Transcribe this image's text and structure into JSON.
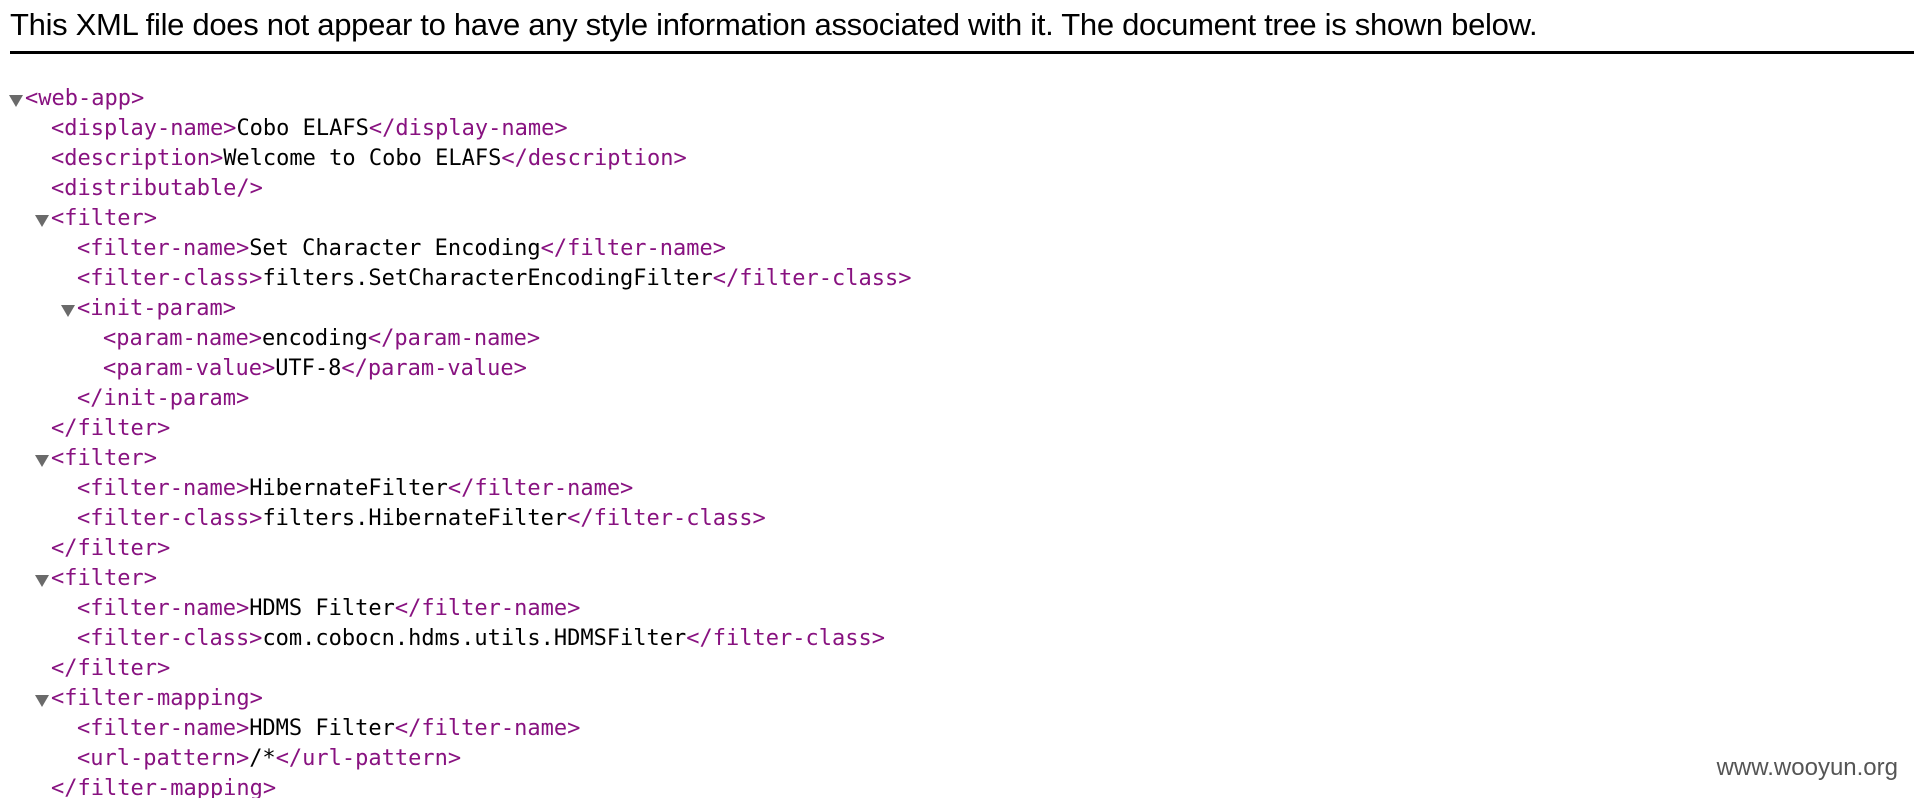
{
  "header": {
    "notice": "This XML file does not appear to have any style information associated with it. The document tree is shown below."
  },
  "tree": [
    {
      "depth": 0,
      "toggle": true,
      "open": "<web-app>"
    },
    {
      "depth": 1,
      "toggle": false,
      "open": "<display-name>",
      "text": "Cobo ELAFS",
      "close": "</display-name>"
    },
    {
      "depth": 1,
      "toggle": false,
      "open": "<description>",
      "text": "Welcome to Cobo ELAFS",
      "close": "</description>"
    },
    {
      "depth": 1,
      "toggle": false,
      "open": "<distributable/>"
    },
    {
      "depth": 1,
      "toggle": true,
      "open": "<filter>"
    },
    {
      "depth": 2,
      "toggle": false,
      "open": "<filter-name>",
      "text": "Set Character Encoding",
      "close": "</filter-name>"
    },
    {
      "depth": 2,
      "toggle": false,
      "open": "<filter-class>",
      "text": "filters.SetCharacterEncodingFilter",
      "close": "</filter-class>"
    },
    {
      "depth": 2,
      "toggle": true,
      "open": "<init-param>"
    },
    {
      "depth": 3,
      "toggle": false,
      "open": "<param-name>",
      "text": "encoding",
      "close": "</param-name>"
    },
    {
      "depth": 3,
      "toggle": false,
      "open": "<param-value>",
      "text": "UTF-8",
      "close": "</param-value>"
    },
    {
      "depth": 2,
      "toggle": false,
      "open": "</init-param>"
    },
    {
      "depth": 1,
      "toggle": false,
      "open": "</filter>"
    },
    {
      "depth": 1,
      "toggle": true,
      "open": "<filter>"
    },
    {
      "depth": 2,
      "toggle": false,
      "open": "<filter-name>",
      "text": "HibernateFilter",
      "close": "</filter-name>"
    },
    {
      "depth": 2,
      "toggle": false,
      "open": "<filter-class>",
      "text": "filters.HibernateFilter",
      "close": "</filter-class>"
    },
    {
      "depth": 1,
      "toggle": false,
      "open": "</filter>"
    },
    {
      "depth": 1,
      "toggle": true,
      "open": "<filter>"
    },
    {
      "depth": 2,
      "toggle": false,
      "open": "<filter-name>",
      "text": "HDMS Filter",
      "close": "</filter-name>"
    },
    {
      "depth": 2,
      "toggle": false,
      "open": "<filter-class>",
      "text": "com.cobocn.hdms.utils.HDMSFilter",
      "close": "</filter-class>"
    },
    {
      "depth": 1,
      "toggle": false,
      "open": "</filter>"
    },
    {
      "depth": 1,
      "toggle": true,
      "open": "<filter-mapping>"
    },
    {
      "depth": 2,
      "toggle": false,
      "open": "<filter-name>",
      "text": "HDMS Filter",
      "close": "</filter-name>"
    },
    {
      "depth": 2,
      "toggle": false,
      "open": "<url-pattern>",
      "text": "/*",
      "close": "</url-pattern>"
    },
    {
      "depth": 1,
      "toggle": false,
      "open": "</filter-mapping>"
    }
  ],
  "watermark": "www.wooyun.org",
  "colors": {
    "tag": "#881280",
    "text": "#000000",
    "toggle": "#6a6a6a"
  },
  "icons": {
    "toggle": "triangle-down-icon"
  }
}
